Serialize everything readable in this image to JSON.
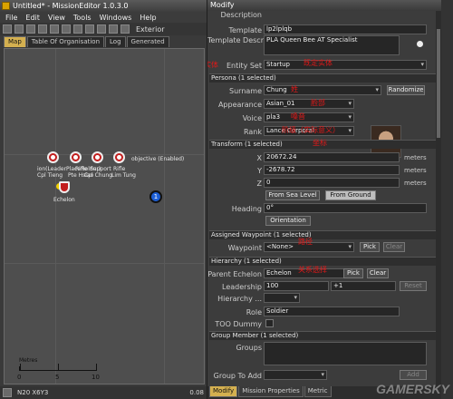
{
  "left_window": {
    "title": "Untitled* - MissionEditor 1.0.3.0",
    "menu": [
      "File",
      "Edit",
      "View",
      "Tools",
      "Windows",
      "Help"
    ],
    "toolbar_exterior": "Exterior",
    "tabs": [
      {
        "label": "Map",
        "active": true
      },
      {
        "label": "Table Of Organisation",
        "active": false
      },
      {
        "label": "Log",
        "active": false
      },
      {
        "label": "Generated",
        "active": false
      }
    ],
    "map": {
      "units": [
        {
          "label": "ion(LeaderPlaceHolder)",
          "sublabel": "Cpl Tieng"
        },
        {
          "label": "Rifle",
          "sublabel": "Pte Hsiao"
        },
        {
          "label": "Support",
          "sublabel": "Cpl Chung"
        },
        {
          "label": "Rifle",
          "sublabel": "Lim Tung"
        }
      ],
      "echelon_label": "Echelon",
      "objective_label": "objective (Enabled)",
      "objective_number": "1",
      "scale_title": "Metres",
      "scale_ticks": [
        "0",
        "5",
        "10"
      ]
    },
    "status": {
      "coords": "N20 X6Y3",
      "zoom": "0.08"
    }
  },
  "right_window": {
    "title": "Modify",
    "fields": {
      "description_label": "Description",
      "template_label": "Template",
      "template_value": "lp2lplqb",
      "template_desc_label": "Template Description",
      "template_desc_value": "PLA Queen Bee AT Specialist",
      "entity_set_label": "Entity Set",
      "entity_set_value": "Startup"
    },
    "persona": {
      "header": "Persona (1 selected)",
      "surname_label": "Surname",
      "surname_value": "Chung",
      "randomize": "Randomize",
      "appearance_label": "Appearance",
      "appearance_value": "Asian_01",
      "voice_label": "Voice",
      "voice_value": "pla3",
      "rank_label": "Rank",
      "rank_value": "Lance Corporal"
    },
    "transform": {
      "header": "Transform (1 selected)",
      "x_label": "X",
      "x_value": "20672.24",
      "y_label": "Y",
      "y_value": "-2678.72",
      "z_label": "Z",
      "z_value": "0",
      "units": "meters",
      "from_sea": "From Sea Level",
      "from_ground": "From Ground",
      "heading_label": "Heading",
      "heading_value": "0°",
      "orientation": "Orientation"
    },
    "waypoint": {
      "header": "Assigned Waypoint (1 selected)",
      "label": "Waypoint",
      "value": "<None>",
      "pick": "Pick",
      "clear": "Clear"
    },
    "hierarchy": {
      "header": "Hierarchy (1 selected)",
      "parent_label": "Parent Echelon",
      "parent_value": "Echelon",
      "pick": "Pick",
      "clear": "Clear",
      "leadership_label": "Leadership",
      "leadership_value": "100",
      "leadership_delta": "+1",
      "reset": "Reset",
      "hierarchy_label": "Hierarchy ...",
      "role_label": "Role",
      "role_value": "Soldier",
      "too_dummy_label": "TOO Dummy"
    },
    "group_member": {
      "header": "Group Member (1 selected)",
      "groups_label": "Groups",
      "group_to_add_label": "Group To Add",
      "add": "Add"
    },
    "bottom_tabs": [
      {
        "label": "Modify",
        "active": true
      },
      {
        "label": "Mission Properties",
        "active": false
      },
      {
        "label": "Metric",
        "active": false
      }
    ],
    "annotations": {
      "entity_set": "实体",
      "startup": "既定实体",
      "surname": "姓",
      "appearance": "脸部",
      "voice": "嗓音",
      "rank": "阶级（实际意义）",
      "transform": "坐标",
      "waypoint": "路径",
      "parent": "关系选择"
    },
    "watermark": "GAMERSKY"
  },
  "colors": {
    "accent_tab": "#d4b050",
    "unit_red": "#c21d1d",
    "objective_blue": "#1c5fd6",
    "annotation_red": "#e01818"
  }
}
